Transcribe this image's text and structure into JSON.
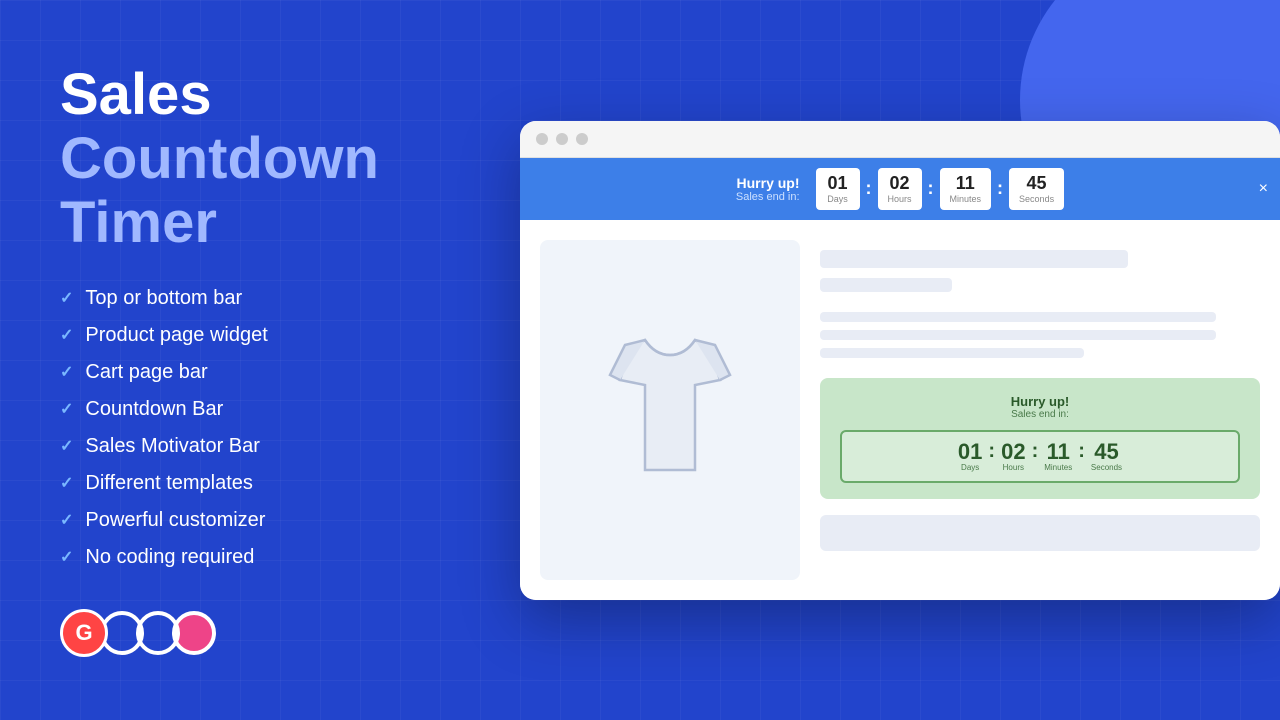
{
  "background": {
    "primary_color": "#2244cc",
    "circle_color": "#4466ee"
  },
  "left": {
    "title_white": "Sales",
    "title_blue": "Countdown Timer",
    "features": [
      "Top or bottom bar",
      "Product page widget",
      "Cart page bar",
      "Countdown Bar",
      "Sales Motivator Bar",
      "Different templates",
      "Powerful customizer",
      "No coding required"
    ]
  },
  "browser": {
    "countdown_bar": {
      "hurry": "Hurry up!",
      "sales_end": "Sales end in:",
      "days": "01",
      "hours": "02",
      "minutes": "11",
      "seconds": "45",
      "days_label": "Days",
      "hours_label": "Hours",
      "minutes_label": "Minutes",
      "seconds_label": "Seconds"
    },
    "product_widget": {
      "hurry": "Hurry up!",
      "sales_end": "Sales end in:",
      "days": "01",
      "hours": "02",
      "minutes": "11",
      "seconds": "45",
      "days_label": "Days",
      "hours_label": "Hours",
      "minutes_label": "Minutes",
      "seconds_label": "Seconds"
    }
  }
}
